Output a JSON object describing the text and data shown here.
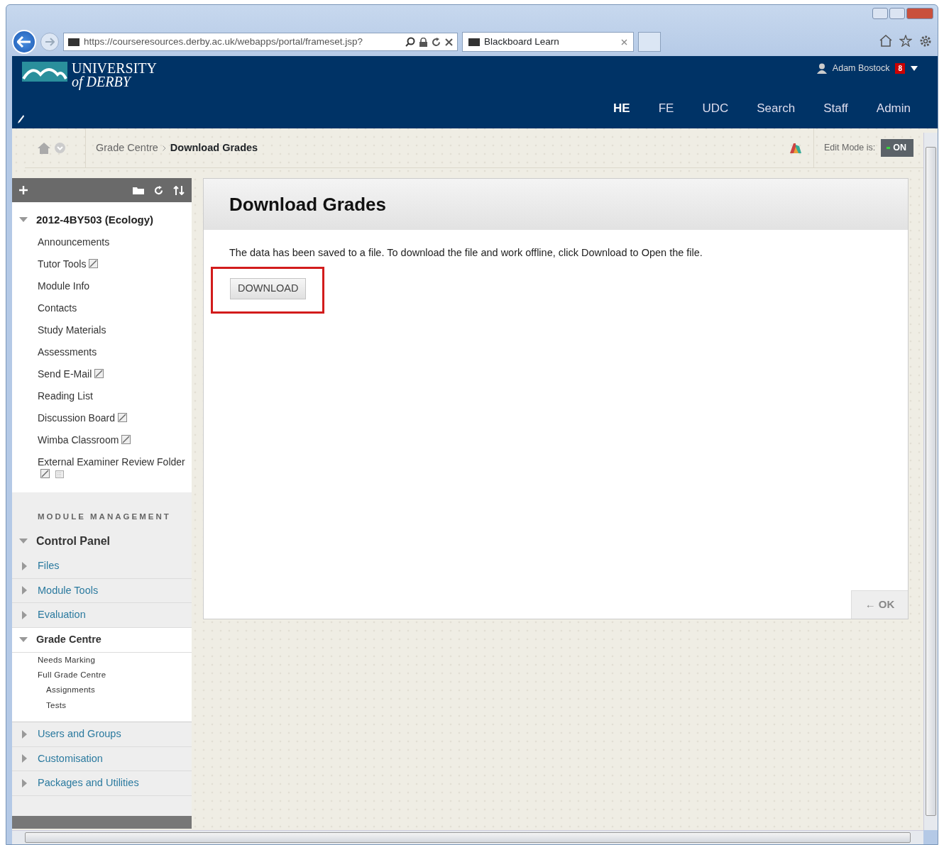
{
  "browser": {
    "url": "https://courseresources.derby.ac.uk/webapps/portal/frameset.jsp?",
    "tab": "Blackboard Learn"
  },
  "header": {
    "logo_line1": "UNIVERSITY",
    "logo_line2": "of DERBY",
    "user": "Adam Bostock",
    "notifications": "8",
    "nav": [
      {
        "label": "HE",
        "selected": true
      },
      {
        "label": "FE",
        "selected": false
      },
      {
        "label": "UDC",
        "selected": false
      },
      {
        "label": "Search",
        "selected": false
      },
      {
        "label": "Staff",
        "selected": false
      },
      {
        "label": "Admin",
        "selected": false
      }
    ]
  },
  "breadcrumb": [
    "Grade Centre",
    "Download Grades"
  ],
  "edit_mode": {
    "label": "Edit Mode is:",
    "value": "ON",
    "on": true
  },
  "course": {
    "title": "2012-4BY503 (Ecology)",
    "expanded": true,
    "items": [
      {
        "label": "Announcements",
        "hidden": false
      },
      {
        "label": "Tutor Tools",
        "hidden": true
      },
      {
        "label": "Module Info",
        "hidden": false
      },
      {
        "label": "Contacts",
        "hidden": false
      },
      {
        "label": "Study Materials",
        "hidden": false
      },
      {
        "label": "Assessments",
        "hidden": false
      },
      {
        "label": "Send E-Mail",
        "hidden": true
      },
      {
        "label": "Reading List",
        "hidden": false
      },
      {
        "label": "Discussion Board",
        "hidden": true
      },
      {
        "label": "Wimba Classroom",
        "hidden": true
      },
      {
        "label": "External Examiner Review Folder",
        "hidden": true,
        "adaptive": true
      }
    ]
  },
  "management": {
    "heading": "MODULE MANAGEMENT",
    "title": "Control Panel",
    "expanded": true,
    "sections": [
      {
        "label": "Files",
        "expanded": false
      },
      {
        "label": "Module Tools",
        "expanded": false
      },
      {
        "label": "Evaluation",
        "expanded": false
      },
      {
        "label": "Grade Centre",
        "expanded": true,
        "children": [
          {
            "label": "Needs Marking"
          },
          {
            "label": "Full Grade Centre",
            "children": [
              {
                "label": "Assignments"
              },
              {
                "label": "Tests"
              }
            ]
          }
        ]
      },
      {
        "label": "Users and Groups",
        "expanded": false
      },
      {
        "label": "Customisation",
        "expanded": false
      },
      {
        "label": "Packages and Utilities",
        "expanded": false
      }
    ]
  },
  "content": {
    "title": "Download Grades",
    "message": "The data has been saved to a file. To download the file and work offline, click Download to Open the file.",
    "button": "DOWNLOAD",
    "highlighted": true,
    "ok": "← OK"
  }
}
